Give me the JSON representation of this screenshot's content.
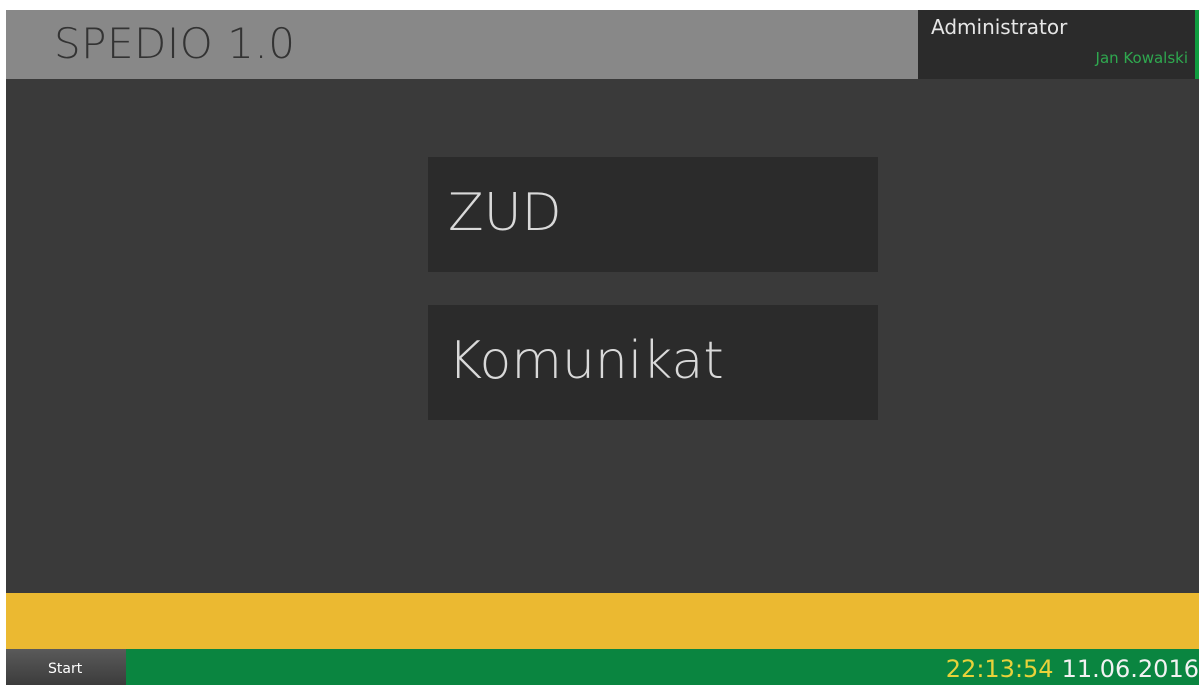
{
  "app": {
    "title": "SPEDIO 1.0"
  },
  "user": {
    "role": "Administrator",
    "name": "Jan Kowalski"
  },
  "tiles": [
    {
      "label": "ZUD"
    },
    {
      "label": "Komunikat"
    }
  ],
  "taskbar": {
    "start_label": "Start",
    "time": "22:13:54",
    "date": "11.06.2016"
  },
  "colors": {
    "background": "#3a3a3a",
    "header": "#888888",
    "tile": "#2b2b2b",
    "banner": "#ebb931",
    "taskbar": "#0a8540",
    "accent_green": "#2fa84f",
    "clock_time": "#e8d23a"
  }
}
